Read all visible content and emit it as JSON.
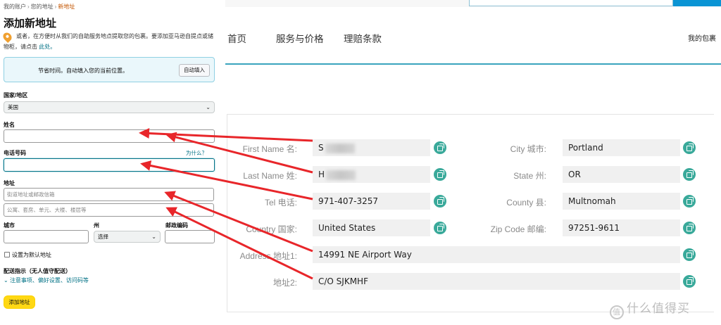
{
  "amazon": {
    "breadcrumb": [
      "我的账户",
      "您的地址",
      "新地址"
    ],
    "breadcrumb_sep": "›",
    "title": "添加新地址",
    "notice": "或者，在方便时从我们的自助服务地点提取您的包裹。要添加亚马逊自提点或储物柜，请点击",
    "notice_link": "此处。",
    "location_message": "节省时间。自动填入您的当前位置。",
    "autofill_button": "自动填入",
    "country_label": "国家/地区",
    "country_value": "美国",
    "name_label": "姓名",
    "phone_label": "电话号码",
    "phone_hint": "为什么？",
    "address_label": "地址",
    "address_line1_placeholder": "街道地址或邮政信箱",
    "address_line2_placeholder": "公寓、套房、单元、大楼、楼层等",
    "city_label": "城市",
    "state_label": "州",
    "state_value": "选择",
    "zip_label": "邮政编码",
    "default_checkbox_label": "设置为默认地址",
    "delivery_heading": "配送指示（无人值守配送）",
    "delivery_link": "注意事项、偏好设置、访问码等",
    "add_button": "添加地址",
    "chevron": "⌄"
  },
  "forwarder": {
    "nav": [
      "首页",
      "服务与价格",
      "理赔条款"
    ],
    "my_parcels": "我的包裹",
    "fields_left": [
      {
        "label": "First Name 名:",
        "value": "S"
      },
      {
        "label": "Last Name 姓:",
        "value": "H"
      },
      {
        "label": "Tel 电话:",
        "value": "971-407-3257"
      },
      {
        "label": "Country 国家:",
        "value": "United States"
      }
    ],
    "fields_right": [
      {
        "label": "City 城市:",
        "value": "Portland"
      },
      {
        "label": "State 州:",
        "value": "OR"
      },
      {
        "label": "County 县:",
        "value": "Multnomah"
      },
      {
        "label": "Zip Code 邮编:",
        "value": "97251-9611"
      }
    ],
    "fields_full": [
      {
        "label": "Address 地址1:",
        "value": "14991 NE Airport Way"
      },
      {
        "label": "地址2:",
        "value": "C/O SJKMHF"
      }
    ]
  },
  "colors": {
    "arrow": "#e8262a",
    "copy_icon": "#39a99a",
    "accent": "#3aa4bd",
    "button": "#ffd814"
  },
  "watermark": "什么值得买",
  "watermark_icon": "值"
}
